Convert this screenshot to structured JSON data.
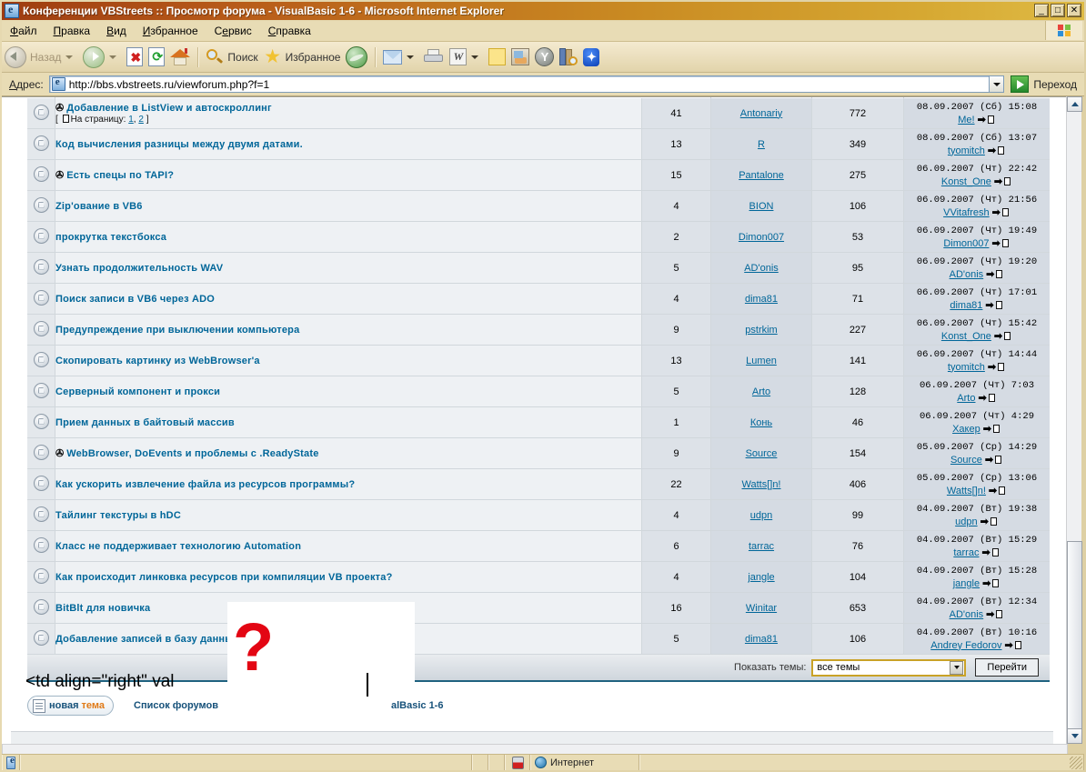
{
  "window": {
    "title": "Конференции VBStreets :: Просмотр форума - VisualBasic 1-6 - Microsoft Internet Explorer",
    "minimize": "_",
    "maximize": "□",
    "close": "✕"
  },
  "menu": {
    "items": [
      "Файл",
      "Правка",
      "Вид",
      "Избранное",
      "Сервис",
      "Справка"
    ]
  },
  "toolbar": {
    "back_label": "Назад",
    "search_label": "Поиск",
    "favorites_label": "Избранное",
    "word_glyph": "W",
    "y_glyph": "Y",
    "bt_glyph": "✦"
  },
  "address": {
    "label": "Адрес:",
    "url": "http://bbs.vbstreets.ru/viewforum.php?f=1",
    "go_label": "Переход"
  },
  "topics": [
    {
      "attach": "✇",
      "title": "Добавление в ListView и автоскроллинг",
      "pages_prefix": "[",
      "pages_label": "На страницу:",
      "pages": [
        "1",
        "2"
      ],
      "pages_suffix": "]",
      "replies": "41",
      "author": "Antonariy",
      "views": "772",
      "last_date": "08.09.2007 (Сб) 15:08",
      "last_author": "Me!"
    },
    {
      "attach": "",
      "title": "Код вычисления разницы между двумя датами.",
      "replies": "13",
      "author": "R",
      "views": "349",
      "last_date": "08.09.2007 (Сб) 13:07",
      "last_author": "tyomitch"
    },
    {
      "attach": "✇",
      "title": "Есть спецы по TAPI?",
      "replies": "15",
      "author": "Pantalone",
      "views": "275",
      "last_date": "06.09.2007 (Чт) 22:42",
      "last_author": "Konst_One"
    },
    {
      "attach": "",
      "title": "Zip'ование в VB6",
      "replies": "4",
      "author": "BION",
      "views": "106",
      "last_date": "06.09.2007 (Чт) 21:56",
      "last_author": "VVitafresh"
    },
    {
      "attach": "",
      "title": "прокрутка текстбокса",
      "replies": "2",
      "author": "Dimon007",
      "views": "53",
      "last_date": "06.09.2007 (Чт) 19:49",
      "last_author": "Dimon007"
    },
    {
      "attach": "",
      "title": "Узнать продолжительность WAV",
      "replies": "5",
      "author": "AD'onis",
      "views": "95",
      "last_date": "06.09.2007 (Чт) 19:20",
      "last_author": "AD'onis"
    },
    {
      "attach": "",
      "title": "Поиск записи в VB6 через ADO",
      "replies": "4",
      "author": "dima81",
      "views": "71",
      "last_date": "06.09.2007 (Чт) 17:01",
      "last_author": "dima81"
    },
    {
      "attach": "",
      "title": "Предупреждение при выключении компьютера",
      "replies": "9",
      "author": "pstrkim",
      "views": "227",
      "last_date": "06.09.2007 (Чт) 15:42",
      "last_author": "Konst_One"
    },
    {
      "attach": "",
      "title": "Скопировать картинку из WebBrowser'а",
      "replies": "13",
      "author": "Lumen",
      "views": "141",
      "last_date": "06.09.2007 (Чт) 14:44",
      "last_author": "tyomitch"
    },
    {
      "attach": "",
      "title": "Серверный компонент и прокси",
      "replies": "5",
      "author": "Arto",
      "views": "128",
      "last_date": "06.09.2007 (Чт) 7:03",
      "last_author": "Arto"
    },
    {
      "attach": "",
      "title": "Прием данных в байтовый массив",
      "replies": "1",
      "author": "Конь",
      "views": "46",
      "last_date": "06.09.2007 (Чт) 4:29",
      "last_author": "Хакер"
    },
    {
      "attach": "✇",
      "title": "WebBrowser, DoEvents и проблемы с .ReadyState",
      "replies": "9",
      "author": "Source",
      "views": "154",
      "last_date": "05.09.2007 (Ср) 14:29",
      "last_author": "Source"
    },
    {
      "attach": "",
      "title": "Как ускорить извлечение файла из ресурсов программы?",
      "replies": "22",
      "author": "Watts[]n!",
      "views": "406",
      "last_date": "05.09.2007 (Ср) 13:06",
      "last_author": "Watts[]n!"
    },
    {
      "attach": "",
      "title": "Тайлинг текстуры в hDC",
      "replies": "4",
      "author": "udpn",
      "views": "99",
      "last_date": "04.09.2007 (Вт) 19:38",
      "last_author": "udpn"
    },
    {
      "attach": "",
      "title": "Класс не поддерживает технологию Automation",
      "replies": "6",
      "author": "tarrac",
      "views": "76",
      "last_date": "04.09.2007 (Вт) 15:29",
      "last_author": "tarrac"
    },
    {
      "attach": "",
      "title": "Как происходит линковка ресурсов при компиляции VB проекта?",
      "replies": "4",
      "author": "jangle",
      "views": "104",
      "last_date": "04.09.2007 (Вт) 15:28",
      "last_author": "jangle"
    },
    {
      "attach": "",
      "title": "BitBlt для новичка",
      "replies": "16",
      "author": "Winitar",
      "views": "653",
      "last_date": "04.09.2007 (Вт) 12:34",
      "last_author": "AD'onis"
    },
    {
      "attach": "",
      "title": "Добавление записей в базу данных",
      "replies": "5",
      "author": "dima81",
      "views": "106",
      "last_date": "04.09.2007 (Вт) 10:16",
      "last_author": "Andrey Fedorov"
    }
  ],
  "table_footer": {
    "jump_label": "Показать темы:",
    "select_value": "все темы",
    "go_button": "Перейти"
  },
  "footer": {
    "new_topic_part1": "новая",
    "new_topic_part2": "тема",
    "forum_list": "Список форумов",
    "breadcrumb_right": "alBasic 1-6"
  },
  "overlay": {
    "question_mark": "?",
    "code_text": "<td align=\"right\" val"
  },
  "status": {
    "zone_label": "Интернет"
  }
}
